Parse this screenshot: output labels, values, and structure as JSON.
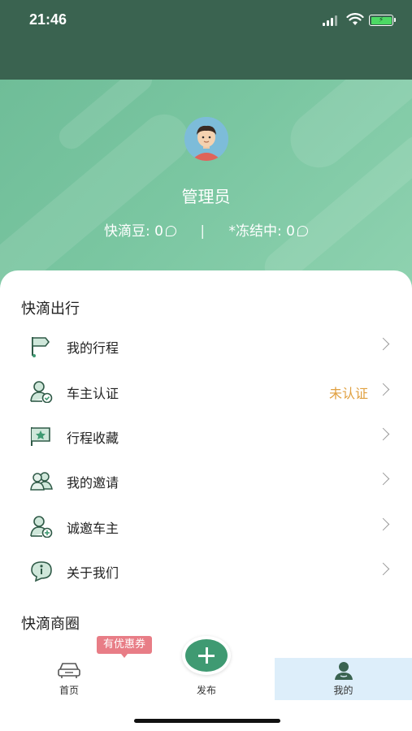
{
  "status_bar": {
    "time": "21:46",
    "battery_color": "#4cd964"
  },
  "profile": {
    "name": "管理员",
    "beans_label": "快滴豆: 0",
    "separator": "|",
    "frozen_label": "*冻结中: 0"
  },
  "sections": {
    "travel_title": "快滴出行",
    "business_title": "快滴商圈"
  },
  "menu": [
    {
      "label": "我的行程",
      "icon": "flag-icon"
    },
    {
      "label": "车主认证",
      "icon": "driver-verify-icon",
      "status": "未认证"
    },
    {
      "label": "行程收藏",
      "icon": "star-flag-icon"
    },
    {
      "label": "我的邀请",
      "icon": "users-icon"
    },
    {
      "label": "诚邀车主",
      "icon": "user-add-icon"
    },
    {
      "label": "关于我们",
      "icon": "info-icon"
    }
  ],
  "tabbar": {
    "home_label": "首页",
    "publish_label": "发布",
    "mine_label": "我的",
    "coupon_badge": "有优惠券"
  },
  "colors": {
    "header_dark": "#3a6350",
    "hero_green": "#7ac6a1",
    "accent_green": "#3f9a72",
    "status_orange": "#e0a040",
    "coupon_pink": "#e87d86",
    "active_tab_bg": "#ddeefa"
  }
}
